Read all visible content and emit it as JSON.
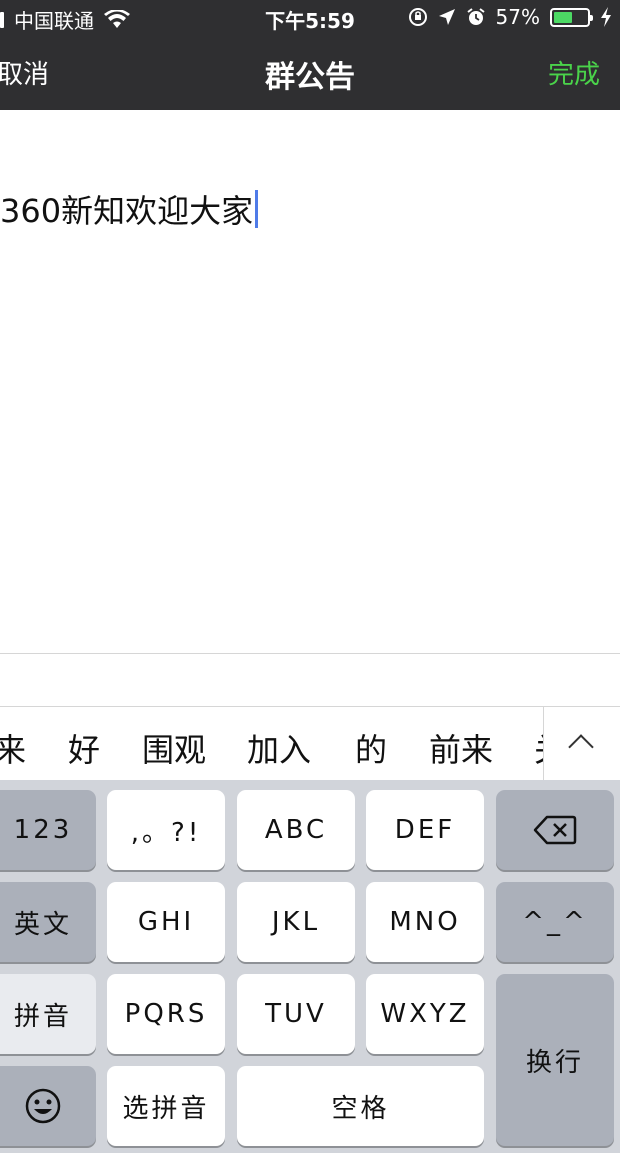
{
  "status_bar": {
    "carrier": "中国联通",
    "time": "下午5:59",
    "battery_percent": "57%",
    "battery_level": 0.57
  },
  "nav": {
    "cancel_label": "取消",
    "title": "群公告",
    "done_label": "完成"
  },
  "editor": {
    "text": "360新知欢迎大家"
  },
  "candidates": {
    "items": [
      "来",
      "好",
      "围观",
      "加入",
      "的",
      "前来",
      "关"
    ],
    "expand_icon": "chevron-up-icon"
  },
  "keyboard": {
    "keys": {
      "num": "123",
      "punct": ",。?!",
      "abc": "ABC",
      "def": "DEF",
      "en": "英文",
      "ghi": "GHI",
      "jkl": "JKL",
      "mno": "MNO",
      "emoticon": "^_^",
      "pinyin": "拼音",
      "pqrs": "PQRS",
      "tuv": "TUV",
      "wxyz": "WXYZ",
      "return": "换行",
      "emoji": "☺",
      "select_pinyin": "选拼音",
      "space": "空格"
    },
    "colors": {
      "key_bg": "#ffffff",
      "func_key_bg": "#abb0ba",
      "keyboard_bg": "#d1d4da"
    }
  },
  "colors": {
    "header_bg": "#2f2f31",
    "done_green": "#4ad34a",
    "caret_blue": "#4f7be8",
    "battery_green": "#4cd964"
  }
}
